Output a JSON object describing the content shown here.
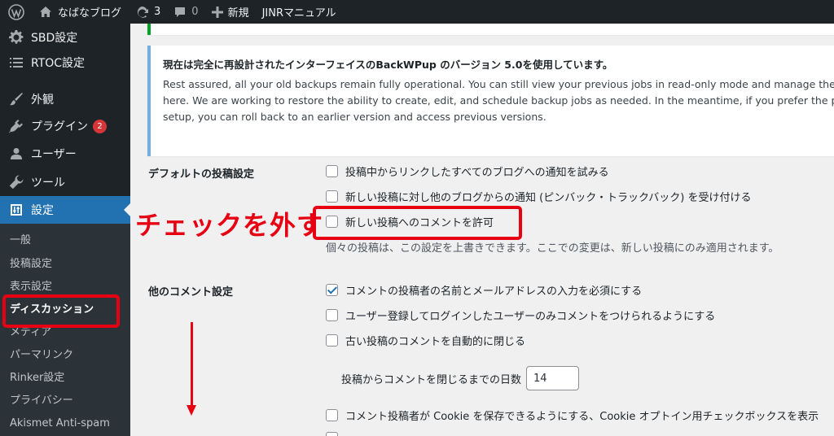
{
  "adminbar": {
    "site_name": "なばなブログ",
    "updates_count": "3",
    "comments_count": "0",
    "new_label": "新規",
    "extra_link": "JINRマニュアル"
  },
  "sidebar": {
    "items": [
      {
        "label": "SBD設定",
        "icon": "gear-icon"
      },
      {
        "label": "RTOC設定",
        "icon": "list-icon"
      },
      {
        "label": "外観",
        "icon": "brush-icon"
      },
      {
        "label": "プラグイン",
        "icon": "plugin-icon",
        "badge": "2"
      },
      {
        "label": "ユーザー",
        "icon": "user-icon"
      },
      {
        "label": "ツール",
        "icon": "wrench-icon"
      },
      {
        "label": "設定",
        "icon": "settings-icon",
        "active": true
      }
    ],
    "submenu": [
      "一般",
      "投稿設定",
      "表示設定",
      "ディスカッション",
      "メディア",
      "パーマリンク",
      "Rinker設定",
      "プライバシー",
      "Akismet Anti-spam"
    ]
  },
  "notice": {
    "title": "現在は完全に再設計されたインターフェイスのBackWPup のバージョン 5.0を使用しています。",
    "body": "Rest assured, all your old backups remain fully operational. You can still view your previous jobs in read-only mode and manage them from here. We are working to restore the ability to create, edit, and schedule backup jobs as needed. In the meantime, if you prefer the previous setup, you can roll back to an earlier version and access previous versions."
  },
  "default_post_settings": {
    "label": "デフォルトの投稿設定",
    "options": [
      {
        "label": "投稿中からリンクしたすべてのブログへの通知を試みる",
        "checked": false
      },
      {
        "label": "新しい投稿に対し他のブログからの通知 (ピンバック・トラックバック) を受け付ける",
        "checked": false
      },
      {
        "label": "新しい投稿へのコメントを許可",
        "checked": false
      }
    ],
    "description": "個々の投稿は、この設定を上書きできます。ここでの変更は、新しい投稿にのみ適用されます。"
  },
  "other_comment_settings": {
    "label": "他のコメント設定",
    "options": [
      {
        "label": "コメントの投稿者の名前とメールアドレスの入力を必須にする",
        "checked": true
      },
      {
        "label": "ユーザー登録してログインしたユーザーのみコメントをつけられるようにする",
        "checked": false
      },
      {
        "label": "古い投稿のコメントを自動的に閉じる",
        "checked": false
      }
    ],
    "days_label": "投稿からコメントを閉じるまでの日数",
    "days_value": "14",
    "cookie_option": "コメント投稿者が Cookie を保存できるようにする、Cookie オプトイン用チェックボックスを表示"
  },
  "annotation": {
    "text": "チェックを外す",
    "color": "#e60012"
  },
  "colors": {
    "adminbar_bg": "#1d2327",
    "active_menu": "#2271b1",
    "notice_border": "#72aee6",
    "badge": "#d63638"
  }
}
